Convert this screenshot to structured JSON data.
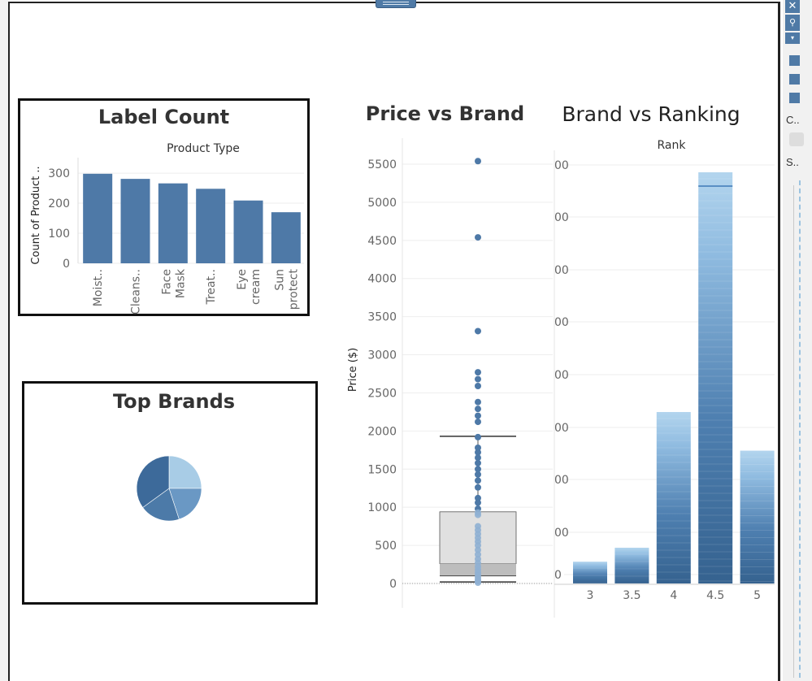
{
  "window": {
    "close_glyph": "✕",
    "pin_glyph": "⚲",
    "dropdown_glyph": "▾",
    "side_labels": [
      "C..",
      "S.."
    ]
  },
  "label_count": {
    "title": "Label Count",
    "header": "Product Type",
    "ylabel": "Count of Product ..",
    "yticks": [
      "300",
      "200",
      "100",
      "0"
    ],
    "xlabels": [
      [
        "Moist.."
      ],
      [
        "Cleans.."
      ],
      [
        "Face",
        "Mask"
      ],
      [
        "Treat.."
      ],
      [
        "Eye",
        "cream"
      ],
      [
        "Sun",
        "protect"
      ]
    ]
  },
  "top_brands": {
    "title": "Top Brands"
  },
  "price_vs_brand": {
    "title": "Price vs Brand",
    "ylabel": "Price ($)",
    "yticks": [
      "5500",
      "5000",
      "4500",
      "4000",
      "3500",
      "3000",
      "2500",
      "2000",
      "1500",
      "1000",
      "500",
      "0"
    ]
  },
  "brand_vs_ranking": {
    "title": "Brand vs Ranking",
    "header": "Rank",
    "ytick_fragments": [
      "00",
      "00",
      "00",
      "00",
      "00",
      "00",
      "00",
      "00",
      "0"
    ],
    "xlabels": [
      "3",
      "3.5",
      "4",
      "4.5",
      "5"
    ]
  },
  "colors": {
    "bar": "#4e79a7",
    "light_blue": "#a8cce6",
    "mid_blue": "#6a98c4",
    "dark_blue": "#3d6a9a",
    "border": "#111111"
  },
  "chart_data": [
    {
      "type": "bar",
      "title": "Label Count",
      "xlabel": "Product Type",
      "ylabel": "Count of Product ..",
      "categories": [
        "Moist..",
        "Cleans..",
        "Face Mask",
        "Treat..",
        "Eye cream",
        "Sun protect"
      ],
      "values": [
        298,
        281,
        266,
        248,
        209,
        170
      ],
      "ylim": [
        0,
        330
      ]
    },
    {
      "type": "pie",
      "title": "Top Brands",
      "values": [
        25,
        20,
        20,
        35
      ]
    },
    {
      "type": "scatter",
      "title": "Price vs Brand",
      "ylabel": "Price ($)",
      "ylim": [
        0,
        5700
      ],
      "y": [
        5540,
        4540,
        3310,
        2770,
        2680,
        2590,
        2380,
        2290,
        2200,
        2120,
        1920,
        1780,
        1720,
        1650,
        1580,
        1500,
        1430,
        1350,
        1260,
        1120,
        1060,
        980,
        930,
        900,
        750,
        700,
        650,
        600,
        550,
        500,
        440,
        380,
        320,
        270,
        220,
        180,
        140,
        110,
        80,
        50,
        30,
        10
      ],
      "boxplot": {
        "whisker_high": 1930,
        "q3": 940,
        "median": 260,
        "q1": 100,
        "whisker_low": 30
      }
    },
    {
      "type": "bar",
      "title": "Brand vs Ranking",
      "xlabel": "Rank",
      "categories": [
        "3",
        "3.5",
        "4",
        "4.5",
        "5"
      ],
      "values": [
        0.053,
        0.087,
        0.417,
        1.0,
        0.323
      ]
    }
  ]
}
